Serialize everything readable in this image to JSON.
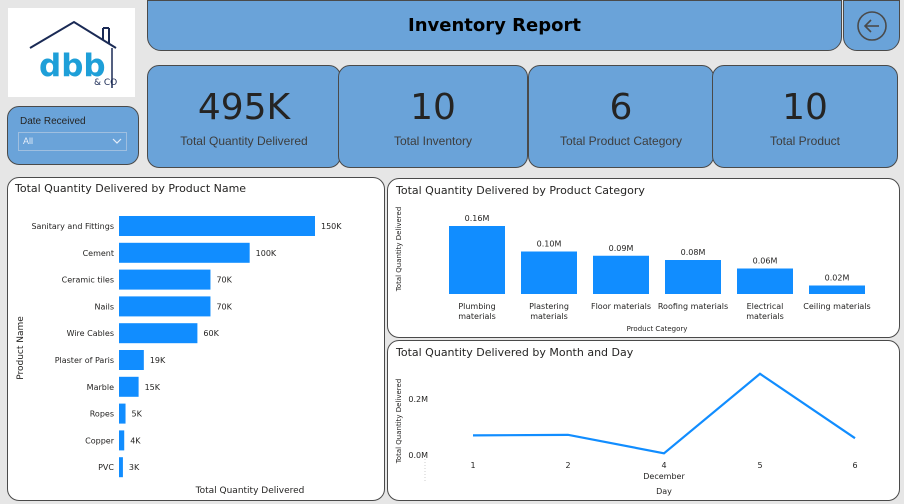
{
  "logo": {
    "brand": "dbb",
    "sub": "& CO"
  },
  "header": {
    "title": "Inventory Report"
  },
  "back_button": {
    "icon": "arrow-left-circle-icon"
  },
  "slicer": {
    "title": "Date Received",
    "value": "All",
    "icon": "chevron-down-icon"
  },
  "kpis": [
    {
      "value": "495K",
      "label": "Total Quantity Delivered"
    },
    {
      "value": "10",
      "label": "Total Inventory"
    },
    {
      "value": "6",
      "label": "Total Product Category"
    },
    {
      "value": "10",
      "label": "Total Product"
    }
  ],
  "colors": {
    "accent": "#6aa3d9",
    "bar": "#118dff",
    "panel_border": "#4a4a4a"
  },
  "chart_data": [
    {
      "type": "bar",
      "orientation": "horizontal",
      "title": "Total Quantity Delivered by Product Name",
      "xlabel": "Total Quantity Delivered",
      "ylabel": "Product Name",
      "categories": [
        "Sanitary and Fittings",
        "Cement",
        "Ceramic tiles",
        "Nails",
        "Wire Cables",
        "Plaster of Paris",
        "Marble",
        "Ropes",
        "Copper",
        "PVC"
      ],
      "values": [
        150000,
        100000,
        70000,
        70000,
        60000,
        19000,
        15000,
        5000,
        4000,
        3000
      ],
      "data_labels": [
        "150K",
        "100K",
        "70K",
        "70K",
        "60K",
        "19K",
        "15K",
        "5K",
        "4K",
        "3K"
      ],
      "xlim": [
        0,
        150000
      ]
    },
    {
      "type": "bar",
      "orientation": "vertical",
      "title": "Total Quantity Delivered by Product Category",
      "xlabel": "Product Category",
      "ylabel": "Total Quantity Delivered",
      "categories": [
        [
          "Plumbing",
          "materials"
        ],
        [
          "Plastering",
          "materials"
        ],
        [
          "Floor materials"
        ],
        [
          "Roofing materials"
        ],
        [
          "Electrical",
          "materials"
        ],
        [
          "Ceiling materials"
        ]
      ],
      "values": [
        160000,
        100000,
        90000,
        80000,
        60000,
        20000
      ],
      "data_labels": [
        "0.16M",
        "0.10M",
        "0.09M",
        "0.08M",
        "0.06M",
        "0.02M"
      ],
      "ylim": [
        0,
        160000
      ]
    },
    {
      "type": "line",
      "title": "Total Quantity Delivered by Month and Day",
      "xlabel": "Day",
      "xlabel_group": "December",
      "ylabel": "Total Quantity Delivered",
      "x": [
        1,
        2,
        4,
        5,
        6
      ],
      "x_labels": [
        "1",
        "2",
        "4",
        "5",
        "6"
      ],
      "y": [
        70000,
        72000,
        6000,
        290000,
        60000
      ],
      "yticks": [
        {
          "v": 0,
          "label": "0.0M"
        },
        {
          "v": 200000,
          "label": "0.2M"
        }
      ],
      "ylim": [
        0,
        300000
      ]
    }
  ]
}
